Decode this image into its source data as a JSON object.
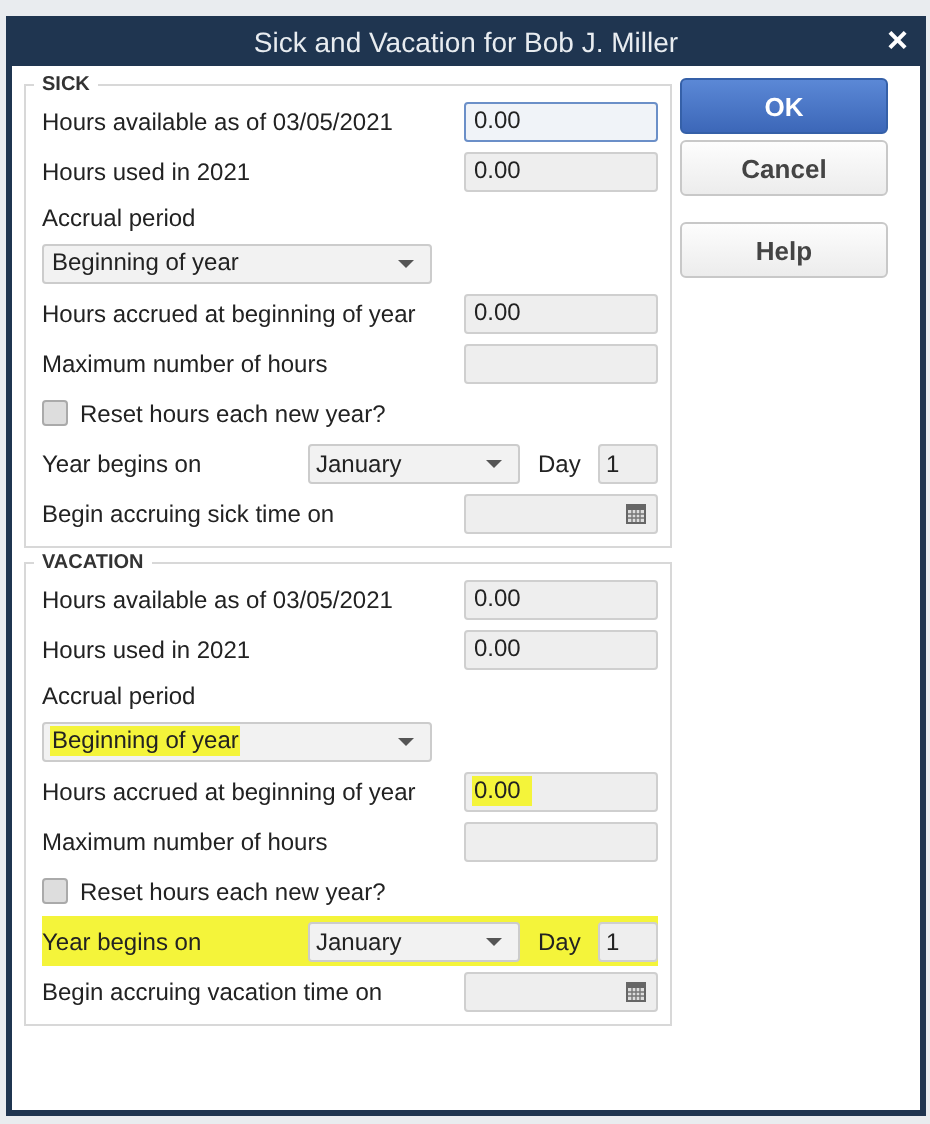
{
  "window": {
    "title": "Sick and Vacation for Bob J. Miller",
    "close": "×"
  },
  "sections": [
    {
      "title": "SICK",
      "rows": [
        {
          "kind": "field",
          "label": "Hours available as of 03/05/2021",
          "value": "0.00",
          "focused": true,
          "highlighted": false
        },
        {
          "kind": "field",
          "label": "Hours used in 2021",
          "value": "0.00",
          "focused": false,
          "highlighted": false
        },
        {
          "kind": "label",
          "label": "Accrual period"
        },
        {
          "kind": "dropdown",
          "value": "Beginning of year",
          "highlighted": false
        },
        {
          "kind": "field",
          "label": "Hours accrued at beginning of year",
          "value": "0.00",
          "focused": false,
          "highlighted": false
        },
        {
          "kind": "field",
          "label": "Maximum number of hours",
          "focused": false,
          "highlighted": false
        },
        {
          "kind": "checkbox",
          "label": "Reset hours each new year?",
          "checked": false
        },
        {
          "kind": "year",
          "label": "Year begins on",
          "month": "January",
          "day_label": "Day",
          "day": "1",
          "highlighted": false
        },
        {
          "kind": "date",
          "label": "Begin accruing sick time on"
        }
      ]
    },
    {
      "title": "VACATION",
      "rows": [
        {
          "kind": "field",
          "label": "Hours available as of 03/05/2021",
          "value": "0.00",
          "focused": false,
          "highlighted": false
        },
        {
          "kind": "field",
          "label": "Hours used in 2021",
          "value": "0.00",
          "focused": false,
          "highlighted": false
        },
        {
          "kind": "label",
          "label": "Accrual period"
        },
        {
          "kind": "dropdown",
          "value": "Beginning of year",
          "highlighted": true
        },
        {
          "kind": "field",
          "label": "Hours accrued at beginning of year",
          "value": "0.00",
          "focused": false,
          "highlighted": true
        },
        {
          "kind": "field",
          "label": "Maximum number of hours",
          "focused": false,
          "highlighted": false
        },
        {
          "kind": "checkbox",
          "label": "Reset hours each new year?",
          "checked": false
        },
        {
          "kind": "year",
          "label": "Year begins on",
          "month": "January",
          "day_label": "Day",
          "day": "1",
          "highlighted": true
        },
        {
          "kind": "date",
          "label": "Begin accruing vacation time on"
        }
      ]
    }
  ],
  "buttons": [
    {
      "label": "OK",
      "primary": true
    },
    {
      "label": "Cancel",
      "primary": false
    },
    {
      "label": "Help",
      "primary": false
    }
  ]
}
